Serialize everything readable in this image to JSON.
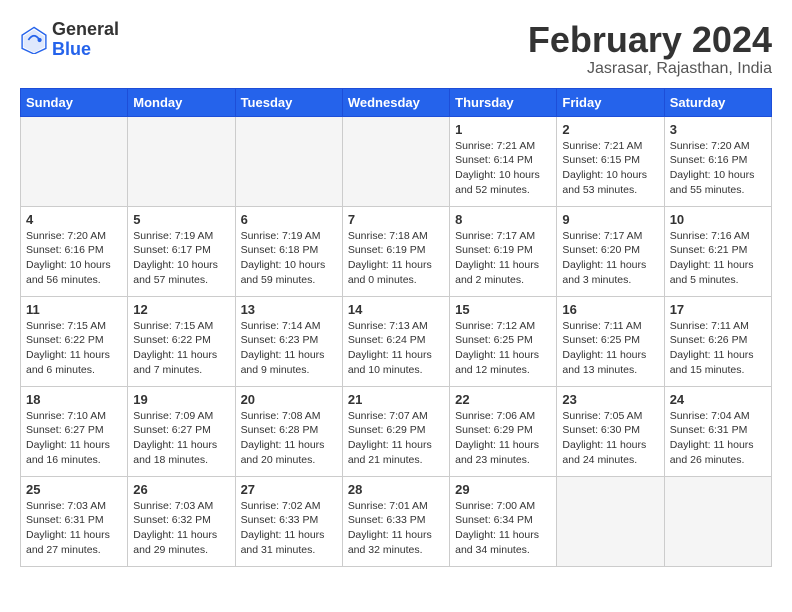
{
  "header": {
    "logo_general": "General",
    "logo_blue": "Blue",
    "month_year": "February 2024",
    "location": "Jasrasar, Rajasthan, India"
  },
  "weekdays": [
    "Sunday",
    "Monday",
    "Tuesday",
    "Wednesday",
    "Thursday",
    "Friday",
    "Saturday"
  ],
  "weeks": [
    [
      {
        "day": "",
        "sunrise": "",
        "sunset": "",
        "daylight": ""
      },
      {
        "day": "",
        "sunrise": "",
        "sunset": "",
        "daylight": ""
      },
      {
        "day": "",
        "sunrise": "",
        "sunset": "",
        "daylight": ""
      },
      {
        "day": "",
        "sunrise": "",
        "sunset": "",
        "daylight": ""
      },
      {
        "day": "1",
        "sunrise": "Sunrise: 7:21 AM",
        "sunset": "Sunset: 6:14 PM",
        "daylight": "Daylight: 10 hours and 52 minutes."
      },
      {
        "day": "2",
        "sunrise": "Sunrise: 7:21 AM",
        "sunset": "Sunset: 6:15 PM",
        "daylight": "Daylight: 10 hours and 53 minutes."
      },
      {
        "day": "3",
        "sunrise": "Sunrise: 7:20 AM",
        "sunset": "Sunset: 6:16 PM",
        "daylight": "Daylight: 10 hours and 55 minutes."
      }
    ],
    [
      {
        "day": "4",
        "sunrise": "Sunrise: 7:20 AM",
        "sunset": "Sunset: 6:16 PM",
        "daylight": "Daylight: 10 hours and 56 minutes."
      },
      {
        "day": "5",
        "sunrise": "Sunrise: 7:19 AM",
        "sunset": "Sunset: 6:17 PM",
        "daylight": "Daylight: 10 hours and 57 minutes."
      },
      {
        "day": "6",
        "sunrise": "Sunrise: 7:19 AM",
        "sunset": "Sunset: 6:18 PM",
        "daylight": "Daylight: 10 hours and 59 minutes."
      },
      {
        "day": "7",
        "sunrise": "Sunrise: 7:18 AM",
        "sunset": "Sunset: 6:19 PM",
        "daylight": "Daylight: 11 hours and 0 minutes."
      },
      {
        "day": "8",
        "sunrise": "Sunrise: 7:17 AM",
        "sunset": "Sunset: 6:19 PM",
        "daylight": "Daylight: 11 hours and 2 minutes."
      },
      {
        "day": "9",
        "sunrise": "Sunrise: 7:17 AM",
        "sunset": "Sunset: 6:20 PM",
        "daylight": "Daylight: 11 hours and 3 minutes."
      },
      {
        "day": "10",
        "sunrise": "Sunrise: 7:16 AM",
        "sunset": "Sunset: 6:21 PM",
        "daylight": "Daylight: 11 hours and 5 minutes."
      }
    ],
    [
      {
        "day": "11",
        "sunrise": "Sunrise: 7:15 AM",
        "sunset": "Sunset: 6:22 PM",
        "daylight": "Daylight: 11 hours and 6 minutes."
      },
      {
        "day": "12",
        "sunrise": "Sunrise: 7:15 AM",
        "sunset": "Sunset: 6:22 PM",
        "daylight": "Daylight: 11 hours and 7 minutes."
      },
      {
        "day": "13",
        "sunrise": "Sunrise: 7:14 AM",
        "sunset": "Sunset: 6:23 PM",
        "daylight": "Daylight: 11 hours and 9 minutes."
      },
      {
        "day": "14",
        "sunrise": "Sunrise: 7:13 AM",
        "sunset": "Sunset: 6:24 PM",
        "daylight": "Daylight: 11 hours and 10 minutes."
      },
      {
        "day": "15",
        "sunrise": "Sunrise: 7:12 AM",
        "sunset": "Sunset: 6:25 PM",
        "daylight": "Daylight: 11 hours and 12 minutes."
      },
      {
        "day": "16",
        "sunrise": "Sunrise: 7:11 AM",
        "sunset": "Sunset: 6:25 PM",
        "daylight": "Daylight: 11 hours and 13 minutes."
      },
      {
        "day": "17",
        "sunrise": "Sunrise: 7:11 AM",
        "sunset": "Sunset: 6:26 PM",
        "daylight": "Daylight: 11 hours and 15 minutes."
      }
    ],
    [
      {
        "day": "18",
        "sunrise": "Sunrise: 7:10 AM",
        "sunset": "Sunset: 6:27 PM",
        "daylight": "Daylight: 11 hours and 16 minutes."
      },
      {
        "day": "19",
        "sunrise": "Sunrise: 7:09 AM",
        "sunset": "Sunset: 6:27 PM",
        "daylight": "Daylight: 11 hours and 18 minutes."
      },
      {
        "day": "20",
        "sunrise": "Sunrise: 7:08 AM",
        "sunset": "Sunset: 6:28 PM",
        "daylight": "Daylight: 11 hours and 20 minutes."
      },
      {
        "day": "21",
        "sunrise": "Sunrise: 7:07 AM",
        "sunset": "Sunset: 6:29 PM",
        "daylight": "Daylight: 11 hours and 21 minutes."
      },
      {
        "day": "22",
        "sunrise": "Sunrise: 7:06 AM",
        "sunset": "Sunset: 6:29 PM",
        "daylight": "Daylight: 11 hours and 23 minutes."
      },
      {
        "day": "23",
        "sunrise": "Sunrise: 7:05 AM",
        "sunset": "Sunset: 6:30 PM",
        "daylight": "Daylight: 11 hours and 24 minutes."
      },
      {
        "day": "24",
        "sunrise": "Sunrise: 7:04 AM",
        "sunset": "Sunset: 6:31 PM",
        "daylight": "Daylight: 11 hours and 26 minutes."
      }
    ],
    [
      {
        "day": "25",
        "sunrise": "Sunrise: 7:03 AM",
        "sunset": "Sunset: 6:31 PM",
        "daylight": "Daylight: 11 hours and 27 minutes."
      },
      {
        "day": "26",
        "sunrise": "Sunrise: 7:03 AM",
        "sunset": "Sunset: 6:32 PM",
        "daylight": "Daylight: 11 hours and 29 minutes."
      },
      {
        "day": "27",
        "sunrise": "Sunrise: 7:02 AM",
        "sunset": "Sunset: 6:33 PM",
        "daylight": "Daylight: 11 hours and 31 minutes."
      },
      {
        "day": "28",
        "sunrise": "Sunrise: 7:01 AM",
        "sunset": "Sunset: 6:33 PM",
        "daylight": "Daylight: 11 hours and 32 minutes."
      },
      {
        "day": "29",
        "sunrise": "Sunrise: 7:00 AM",
        "sunset": "Sunset: 6:34 PM",
        "daylight": "Daylight: 11 hours and 34 minutes."
      },
      {
        "day": "",
        "sunrise": "",
        "sunset": "",
        "daylight": ""
      },
      {
        "day": "",
        "sunrise": "",
        "sunset": "",
        "daylight": ""
      }
    ]
  ]
}
